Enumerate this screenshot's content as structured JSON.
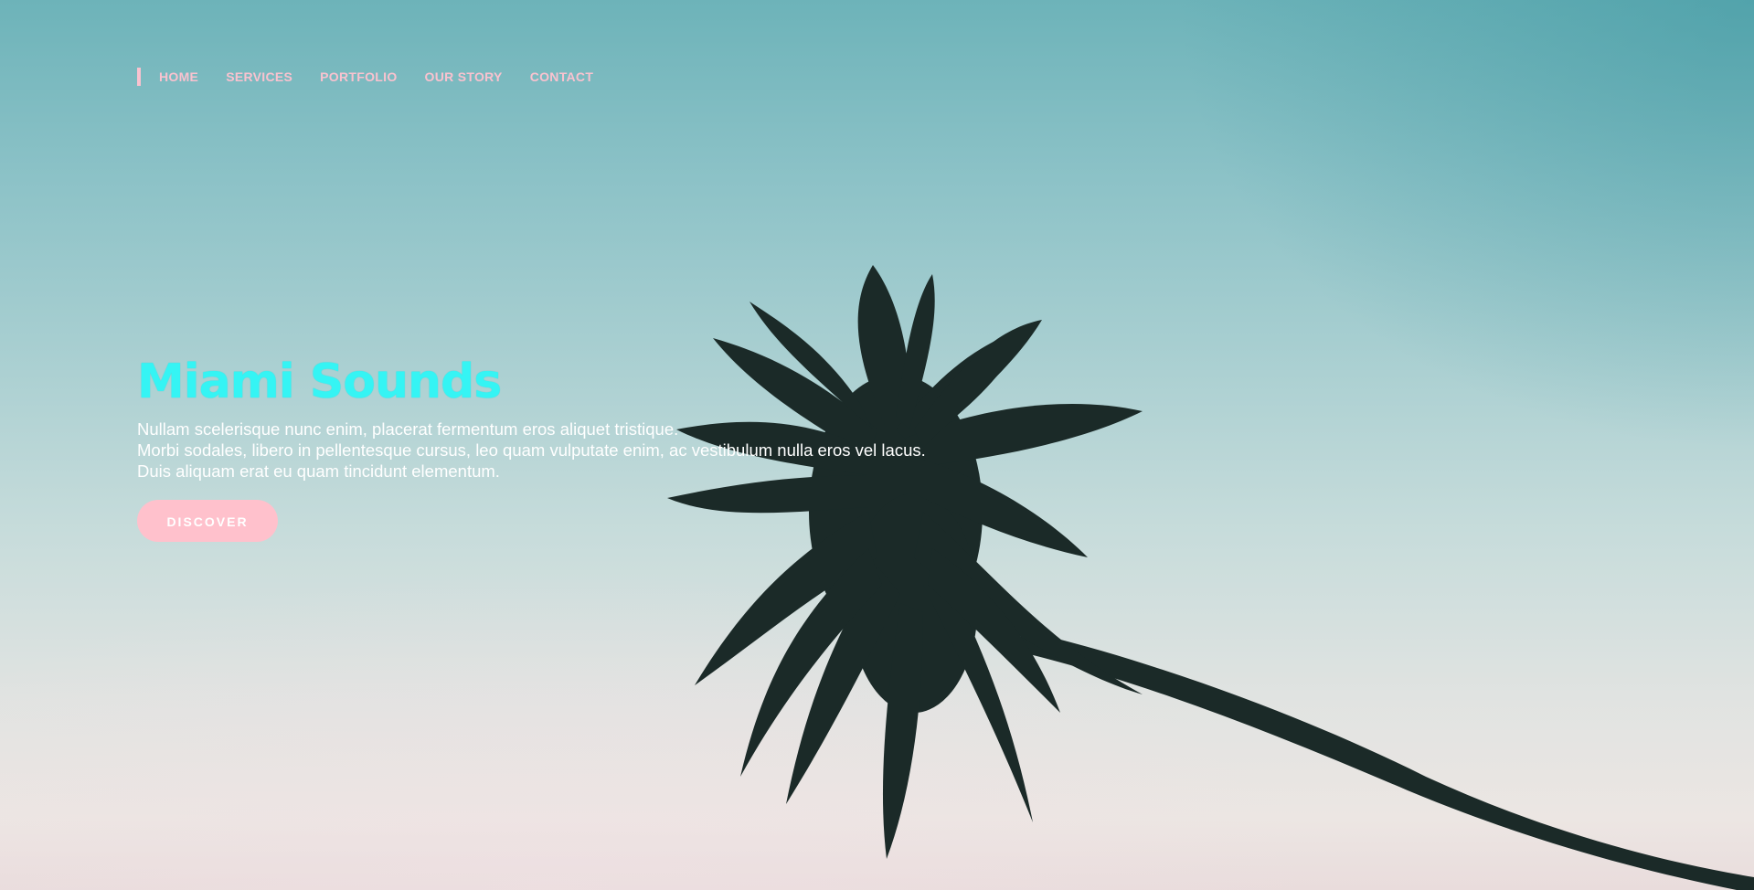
{
  "nav": {
    "items": [
      {
        "label": "HOME"
      },
      {
        "label": "SERVICES"
      },
      {
        "label": "PORTFOLIO"
      },
      {
        "label": "OUR STORY"
      },
      {
        "label": "CONTACT"
      }
    ]
  },
  "hero": {
    "title": "Miami Sounds",
    "description": [
      "Nullam scelerisque nunc enim, placerat fermentum eros aliquet tristique.",
      "Morbi sodales, libero in pellentesque cursus, leo quam vulputate enim, ac vestibulum nulla eros vel lacus.",
      "Duis aliquam erat eu quam tincidunt elementum."
    ],
    "cta_label": "DISCOVER"
  },
  "colors": {
    "nav_text": "#f9c2cf",
    "title": "#35f4f4",
    "button_bg": "#ffc1cc",
    "palm": "#1b2a28"
  },
  "background": {
    "image_subject": "palm-tree-silhouette-against-sky"
  }
}
